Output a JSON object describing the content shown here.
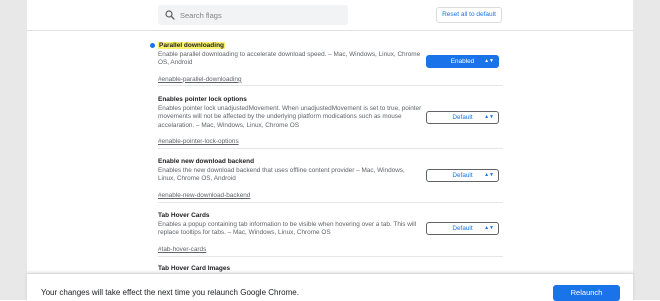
{
  "search": {
    "placeholder": "Search flags"
  },
  "toolbar": {
    "reset_label": "Reset all to default"
  },
  "flags": [
    {
      "title": "Parallel downloading",
      "description": "Enable parallel downloading to accelerate download speed. – Mac, Windows, Linux, Chrome OS, Android",
      "link": "#enable-parallel-downloading",
      "value": "Enabled",
      "modified": true
    },
    {
      "title": "Enables pointer lock options",
      "description": "Enables pointer lock unadjustedMovement. When unadjustedMovement is set to true, pointer movements will not be affected by the underlying platform modications such as mouse accelaration. – Mac, Windows, Linux, Chrome OS",
      "link": "#enable-pointer-lock-options",
      "value": "Default"
    },
    {
      "title": "Enable new download backend",
      "description": "Enables the new download backend that uses offline content provider – Mac, Windows, Linux, Chrome OS, Android",
      "link": "#enable-new-download-backend",
      "value": "Default"
    },
    {
      "title": "Tab Hover Cards",
      "description": "Enables a popup containing tab information to be visible when hovering over a tab. This will replace tooltips for tabs. – Mac, Windows, Linux, Chrome OS",
      "link": "#tab-hover-cards",
      "value": "Default"
    },
    {
      "title": "Tab Hover Card Images"
    }
  ],
  "bottom_bar": {
    "message": "Your changes will take effect the next time you relaunch Google Chrome.",
    "relaunch_label": "Relaunch"
  },
  "icons": {
    "search": "search-icon",
    "select_arrows": "chevron-updown-icon",
    "modified_dot": "dot-indicator"
  },
  "colors": {
    "accent": "#1a73e8",
    "highlight": "#fbf16f",
    "text": "#202124",
    "secondary_text": "#5f6368"
  }
}
